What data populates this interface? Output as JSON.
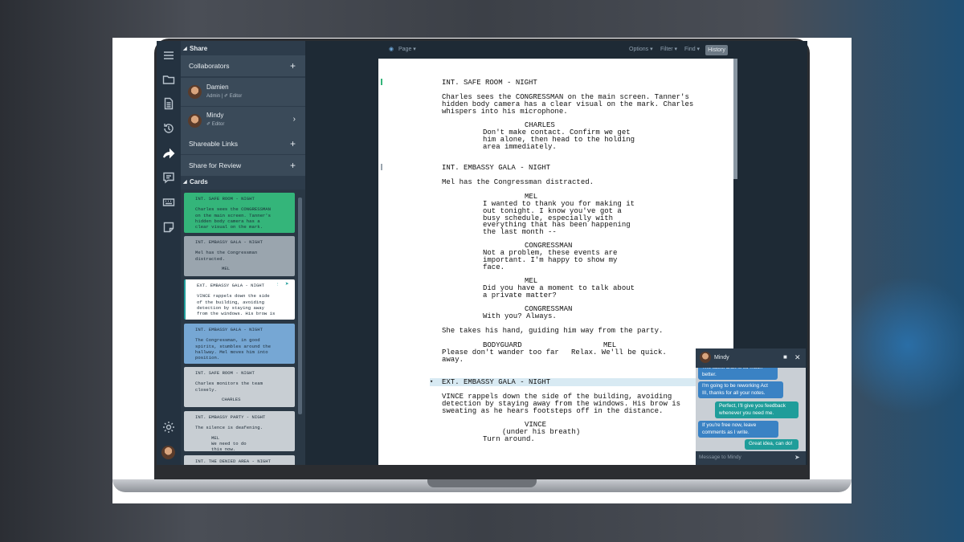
{
  "share_panel": {
    "title": "Share",
    "collaborators_label": "Collaborators",
    "collaborators": [
      {
        "name": "Damien",
        "role": "Admin | ✐ Editor"
      },
      {
        "name": "Mindy",
        "role": "✐ Editor"
      }
    ],
    "shareable_links_label": "Shareable Links",
    "share_review_label": "Share for Review",
    "cards_label": "Cards"
  },
  "cards": [
    {
      "title": "INT. SAFE ROOM - NIGHT",
      "body": "Charles sees the CONGRESSMAN\non the main screen. Tanner's\nhidden body camera has a\nclear visual on the mark.",
      "char": "",
      "color": "#34b57a"
    },
    {
      "title": "INT. EMBASSY GALA - NIGHT",
      "body": "Mel has the Congressman\ndistracted.",
      "char": "MEL",
      "color": "#9aa5ae"
    },
    {
      "title": "EXT. EMBASSY GALA - NIGHT",
      "body": "VINCE rappels down the side\nof the building, avoiding\ndetection by staying away\nfrom the windows. His brow is",
      "char": "",
      "color": "#ffffff"
    },
    {
      "title": "INT. EMBASSY GALA - NIGHT",
      "body": "The Congressman, in good\nspirits, stumbles around the\nhallway. Mel moves him into\nposition.",
      "char": "",
      "color": "#76a7d4"
    },
    {
      "title": "INT. SAFE ROOM - NIGHT",
      "body": "Charles monitors the team\nclosely.",
      "char": "CHARLES",
      "color": "#c8ced3"
    },
    {
      "title": "INT. EMBASSY PARTY - NIGHT",
      "body": "The silence is deafening.",
      "char": "MEL\nWe need to do\nthis now.",
      "color": "#c8ced3"
    },
    {
      "title": "INT. THE DENIED AREA - NIGHT",
      "body": "",
      "char": "",
      "color": "#c8ced3"
    }
  ],
  "topbar": {
    "page_label": "Page ▾",
    "options_label": "Options ▾",
    "filter_label": "Filter ▾",
    "find_label": "Find ▾",
    "history_label": "History"
  },
  "script": {
    "scene1_heading": "INT. SAFE ROOM - NIGHT",
    "scene1_action": "Charles sees the CONGRESSMAN on the main screen. Tanner's\nhidden body camera has a clear visual on the mark. Charles\nwhispers into his microphone.",
    "charles_name": "CHARLES",
    "charles_line": "Don't make contact. Confirm we get\nhim alone, then head to the holding\narea immediately.",
    "scene2_heading": "INT. EMBASSY GALA - NIGHT",
    "scene2_action": "Mel has the Congressman distracted.",
    "mel_name": "MEL",
    "mel_line": "I wanted to thank you for making it\nout tonight. I know you've got a\nbusy schedule, especially with\neverything that has been happening\nthe last month --",
    "congress_name": "CONGRESSMAN",
    "congress_line": "Not a problem, these events are\nimportant. I'm happy to show my\nface.",
    "mel2_name": "MEL",
    "mel2_line": "Did you have a moment to talk about\na private matter?",
    "congress2_name": "CONGRESSMAN",
    "congress2_line": "With you? Always.",
    "scene2_action2": "She takes his hand, guiding him way from the party.",
    "bodyguard_name": "BODYGUARD",
    "bodyguard_line": "Please don't wander too far\naway.",
    "mel3_name": "MEL",
    "mel3_line": "Relax. We'll be quick.",
    "scene3_heading": "EXT. EMBASSY GALA - NIGHT",
    "scene3_action": "VINCE rappels down the side of the building, avoiding\ndetection by staying away from the windows. His brow is\nsweating as he hears footsteps off in the distance.",
    "vince_name": "VINCE",
    "vince_paren": "(under his breath)",
    "vince_line": "Turn around."
  },
  "chat": {
    "contact_name": "Mindy",
    "messages": [
      {
        "text": "The latest draft is so much\nbetter.",
        "from": "them"
      },
      {
        "text": "I'm going to be reworking Act\nIII, thanks for all your notes.",
        "from": "them"
      },
      {
        "text": "Perfect, I'll give you feedback\nwhenever you need me.",
        "from": "me"
      },
      {
        "text": "If you're free now, leave\ncomments as I write.",
        "from": "them"
      },
      {
        "text": "Great idea, can do!",
        "from": "me"
      }
    ],
    "input_placeholder": "Message to Mindy"
  },
  "colors": {
    "rail": "#243240",
    "panel": "#2d3c4b",
    "editor_bg": "#1e2a35",
    "accent_green": "#34b57a",
    "accent_teal": "#1f9d9a"
  }
}
